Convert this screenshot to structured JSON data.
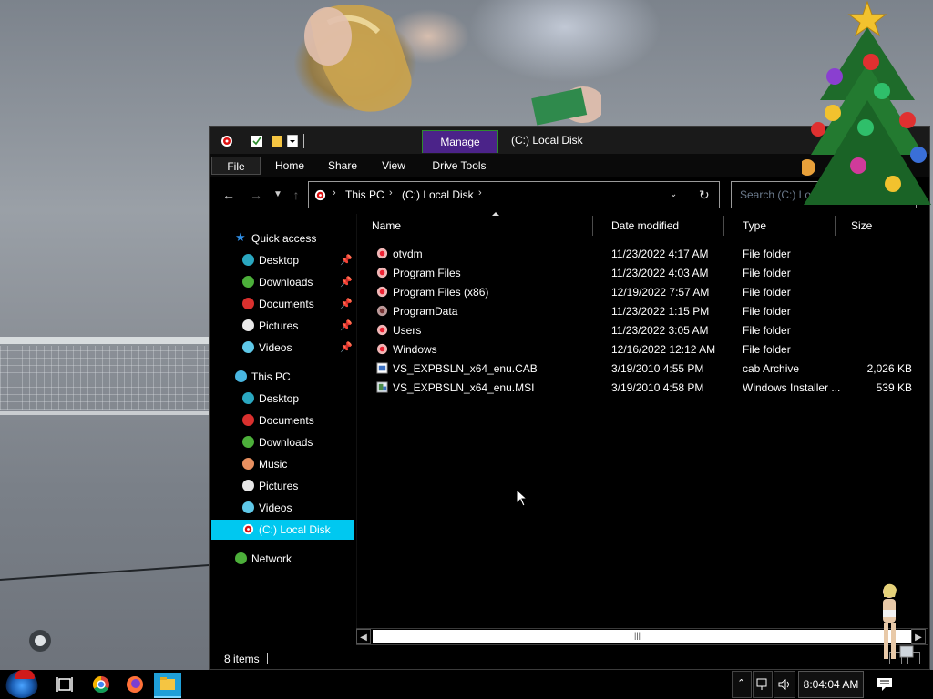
{
  "window": {
    "title": "(C:) Local Disk",
    "contextual_tab": "Manage",
    "ribbon_tabs": [
      "File",
      "Home",
      "Share",
      "View",
      "Drive Tools"
    ]
  },
  "address": {
    "breadcrumbs": [
      "This PC",
      "(C:) Local Disk"
    ]
  },
  "search": {
    "placeholder": "Search (C:) Local Disk",
    "visible_text": "Search (C:) Lo"
  },
  "nav_pane": {
    "quick_access": {
      "label": "Quick access",
      "items": [
        {
          "label": "Desktop",
          "icon": "desktop-icon",
          "pinned": true
        },
        {
          "label": "Downloads",
          "icon": "downloads-icon",
          "pinned": true
        },
        {
          "label": "Documents",
          "icon": "documents-icon",
          "pinned": true
        },
        {
          "label": "Pictures",
          "icon": "pictures-icon",
          "pinned": true
        },
        {
          "label": "Videos",
          "icon": "videos-icon",
          "pinned": true
        }
      ]
    },
    "this_pc": {
      "label": "This PC",
      "items": [
        {
          "label": "Desktop",
          "icon": "desktop-icon"
        },
        {
          "label": "Documents",
          "icon": "documents-icon"
        },
        {
          "label": "Downloads",
          "icon": "downloads-icon"
        },
        {
          "label": "Music",
          "icon": "music-icon"
        },
        {
          "label": "Pictures",
          "icon": "pictures-icon"
        },
        {
          "label": "Videos",
          "icon": "videos-icon"
        },
        {
          "label": "(C:) Local Disk",
          "icon": "drive-icon",
          "selected": true
        }
      ]
    },
    "network": {
      "label": "Network"
    }
  },
  "columns": {
    "name": "Name",
    "date": "Date modified",
    "type": "Type",
    "size": "Size"
  },
  "files": [
    {
      "name": "otvdm",
      "date": "11/23/2022 4:17 AM",
      "type": "File folder",
      "size": "",
      "icon": "folder-icon"
    },
    {
      "name": "Program Files",
      "date": "11/23/2022 4:03 AM",
      "type": "File folder",
      "size": "",
      "icon": "folder-icon"
    },
    {
      "name": "Program Files (x86)",
      "date": "12/19/2022 7:57 AM",
      "type": "File folder",
      "size": "",
      "icon": "folder-icon"
    },
    {
      "name": "ProgramData",
      "date": "11/23/2022 1:15 PM",
      "type": "File folder",
      "size": "",
      "icon": "folder-icon"
    },
    {
      "name": "Users",
      "date": "11/23/2022 3:05 AM",
      "type": "File folder",
      "size": "",
      "icon": "folder-icon"
    },
    {
      "name": "Windows",
      "date": "12/16/2022 12:12 AM",
      "type": "File folder",
      "size": "",
      "icon": "folder-icon"
    },
    {
      "name": "VS_EXPBSLN_x64_enu.CAB",
      "date": "3/19/2010 4:55 PM",
      "type": "cab Archive",
      "size": "2,026 KB",
      "icon": "cab-file-icon"
    },
    {
      "name": "VS_EXPBSLN_x64_enu.MSI",
      "date": "3/19/2010 4:58 PM",
      "type": "Windows Installer ...",
      "size": "539 KB",
      "icon": "msi-file-icon"
    }
  ],
  "status": {
    "item_count": "8 items"
  },
  "taskbar": {
    "clock": "8:04:04 AM",
    "apps": [
      "task-view",
      "chrome",
      "firefox",
      "file-explorer"
    ]
  },
  "colors": {
    "selection": "#00c8f0",
    "manage_tab": "#4b2389",
    "taskbar_active": "#1f9fd8",
    "window_bg": "#000000"
  }
}
